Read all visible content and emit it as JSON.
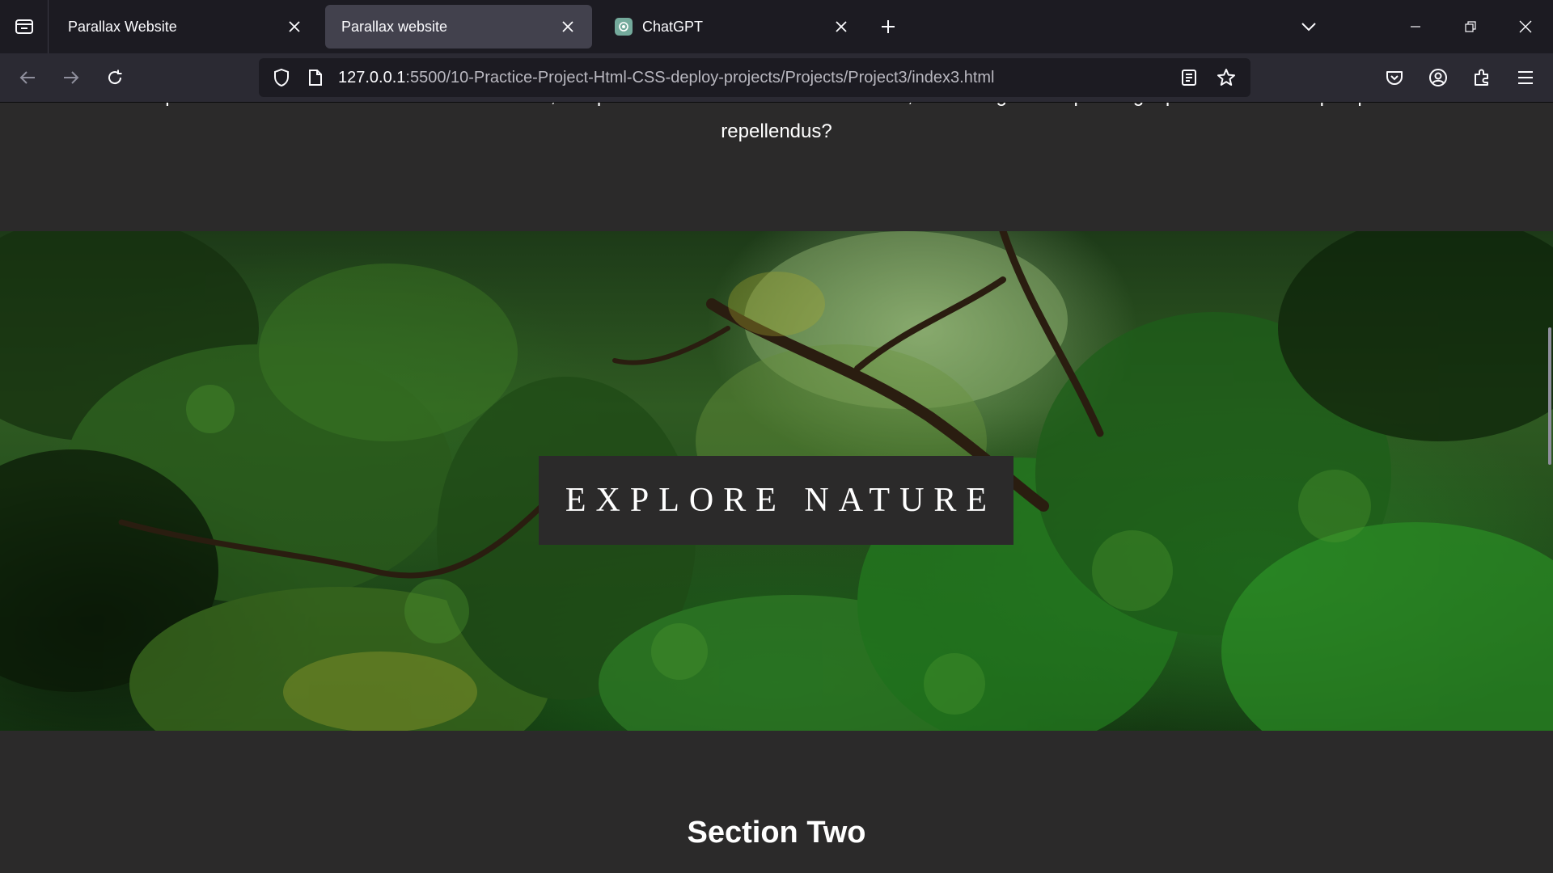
{
  "browser": {
    "tabs": [
      {
        "title": "Parallax Website",
        "active": false
      },
      {
        "title": "Parallax website",
        "active": true
      },
      {
        "title": "ChatGPT",
        "active": false,
        "favicon": "chatgpt-icon"
      }
    ],
    "url_host": "127.0.0.1",
    "url_rest": ":5500/10-Practice-Project-Html-CSS-deploy-projects/Projects/Project3/index3.html"
  },
  "page": {
    "paragraph_line1": "voluptates eos error nulla assumenda totam nam, voluptatem earum? Recusandae mollitia, debitis fugiat excepturi fugit quaerat sed. Cumque quo velit",
    "paragraph_line2": "repellendus?",
    "hero_title": "EXPLORE NATURE",
    "section_title": "Section Two"
  },
  "colors": {
    "page_bg": "#2b2a2a",
    "tabstrip_bg": "#1c1b22",
    "active_tab_bg": "#42414d",
    "navbar_bg": "#2b2a33"
  }
}
